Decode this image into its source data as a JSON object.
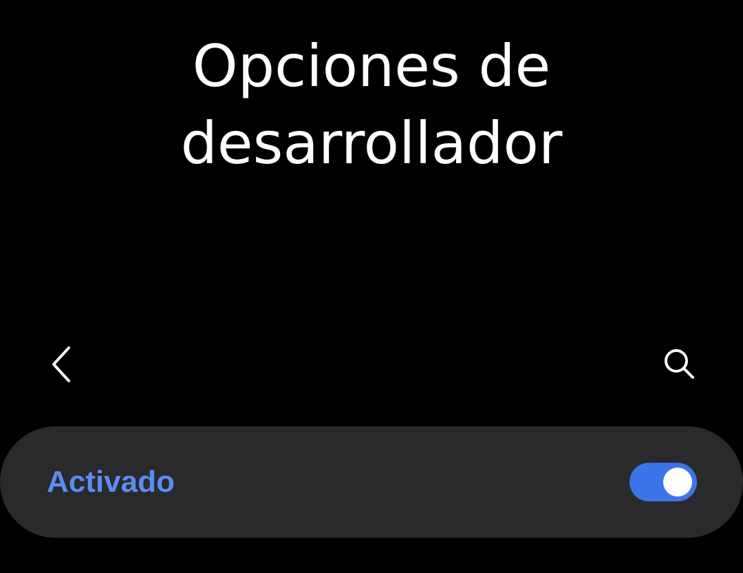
{
  "header": {
    "title_line1": "Opciones de",
    "title_line2": "desarrollador"
  },
  "toolbar": {
    "back_icon": "chevron-left-icon",
    "search_icon": "search-icon"
  },
  "master_switch": {
    "label": "Activado",
    "checked": true
  },
  "colors": {
    "accent": "#3e74ea",
    "label_accent": "#5b8def",
    "card_background": "#2a2a2d",
    "background": "#000000"
  }
}
